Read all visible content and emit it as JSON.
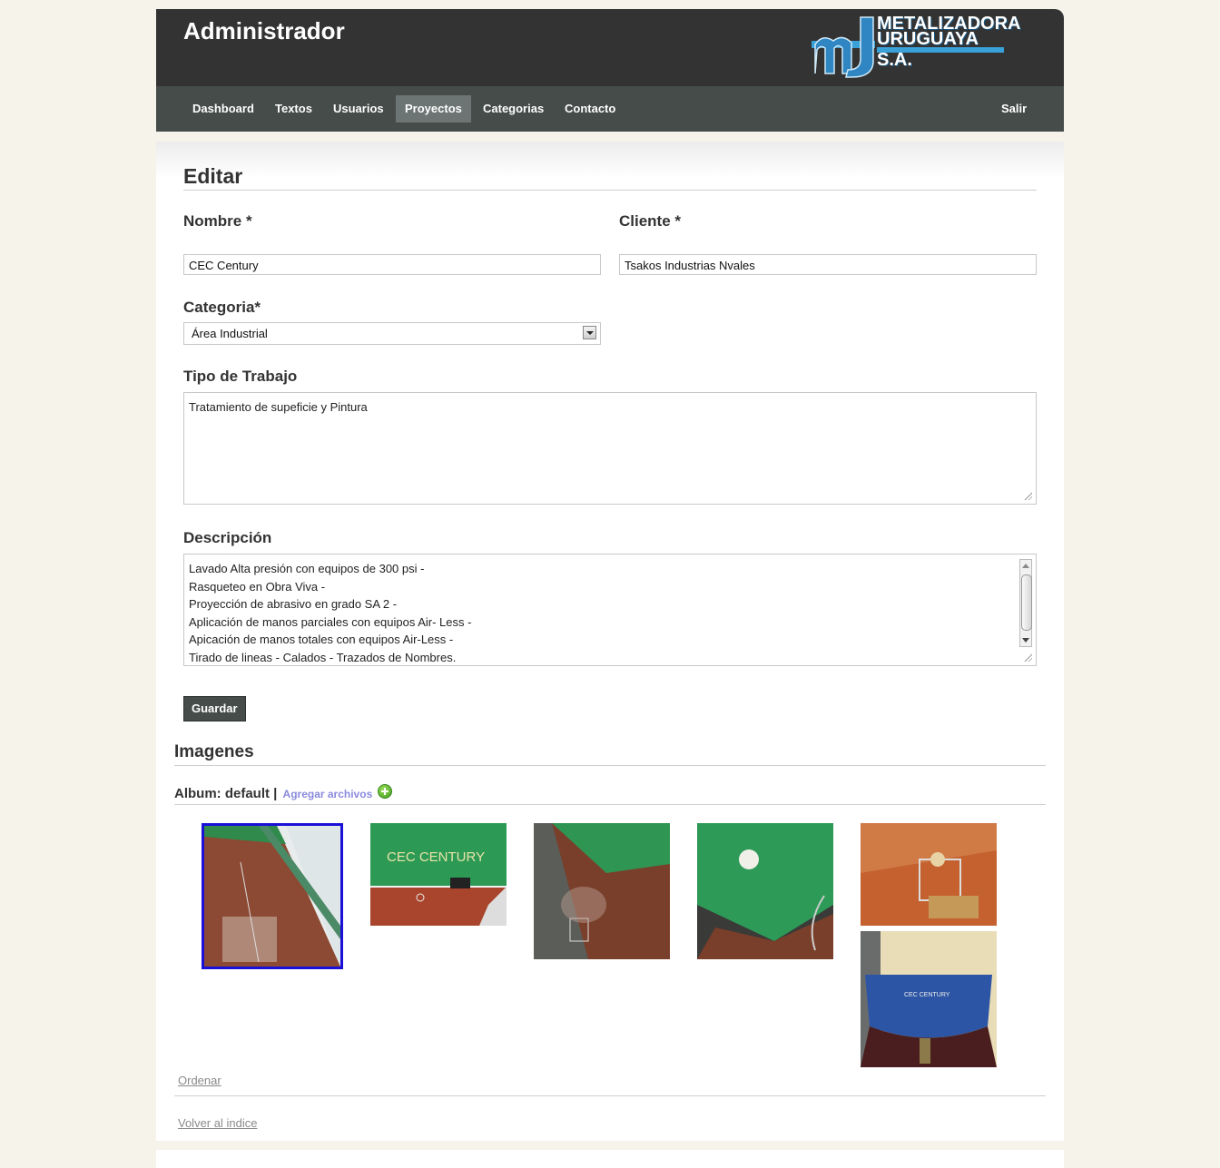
{
  "header": {
    "title": "Administrador",
    "logo_line1": "METALIZADORA",
    "logo_line2": "URUGUAYA S.A."
  },
  "nav": {
    "items": [
      "Dashboard",
      "Textos",
      "Usuarios",
      "Proyectos",
      "Categorias",
      "Contacto"
    ],
    "active": "Proyectos",
    "logout": "Salir"
  },
  "form": {
    "heading": "Editar",
    "nombre_label": "Nombre *",
    "nombre_value": "CEC Century",
    "cliente_label": "Cliente *",
    "cliente_value": "Tsakos Industrias Nvales",
    "categoria_label": "Categoria*",
    "categoria_value": "Área Industrial",
    "tipo_label": "Tipo de Trabajo",
    "tipo_value": "Tratamiento de supeficie y Pintura",
    "descripcion_label": "Descripción",
    "descripcion_lines": [
      "Lavado Alta presión con equipos de 300 psi -",
      "Rasqueteo en Obra Viva -",
      "Proyección de abrasivo en grado SA 2 -",
      "Aplicación de manos parciales con equipos Air- Less -",
      "Apicación de manos totales con equipos Air-Less -",
      "Tirado de lineas - Calados - Trazados de Nombres."
    ],
    "save_label": "Guardar"
  },
  "images": {
    "heading": "Imagenes",
    "album_prefix": "Album: default |",
    "add_files": "Agregar archivos",
    "thumb_text": "CEC CENTURY",
    "order_link": "Ordenar",
    "back_link": "Volver al indice"
  }
}
